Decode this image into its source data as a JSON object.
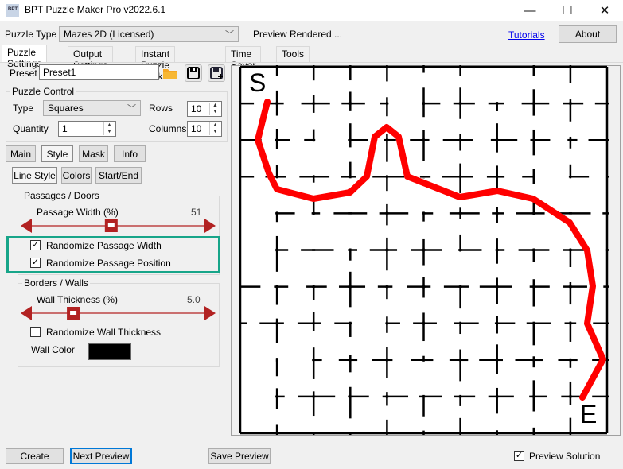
{
  "window": {
    "title": "BPT Puzzle Maker Pro v2022.6.1",
    "icon": "bpt-app-icon",
    "icon_text": "BPT",
    "minimize": "—",
    "maximize": "☐",
    "close": "✕"
  },
  "header": {
    "puzzle_type_label": "Puzzle Type",
    "puzzle_type_value": "Mazes 2D (Licensed)",
    "status": "Preview Rendered ...",
    "tutorials_link": "Tutorials",
    "about_button": "About"
  },
  "tabs": [
    {
      "label": "Puzzle Settings",
      "active": true
    },
    {
      "label": "Output Settings",
      "active": false
    },
    {
      "label": "Instant Puzzle Books",
      "active": false
    },
    {
      "label": "Time Saver",
      "active": false
    },
    {
      "label": "Tools",
      "active": false
    }
  ],
  "preset": {
    "label": "Preset",
    "value": "Preset1",
    "open_icon": "folder-icon",
    "save_icon": "save-icon",
    "save_as_icon": "save-plus-icon"
  },
  "puzzle_control": {
    "title": "Puzzle Control",
    "type_label": "Type",
    "type_value": "Squares",
    "rows_label": "Rows",
    "rows_value": "10",
    "quantity_label": "Quantity",
    "quantity_value": "1",
    "columns_label": "Columns",
    "columns_value": "10"
  },
  "sub_tabs": [
    {
      "label": "Main",
      "active": false
    },
    {
      "label": "Style",
      "active": true
    },
    {
      "label": "Mask",
      "active": false
    },
    {
      "label": "Info",
      "active": false
    }
  ],
  "style_tabs": [
    {
      "label": "Line Style",
      "active": true
    },
    {
      "label": "Colors",
      "active": false
    },
    {
      "label": "Start/End",
      "active": false
    }
  ],
  "passages": {
    "title": "Passages / Doors",
    "slider_label": "Passage Width (%)",
    "slider_value": "51",
    "slider_fraction": 0.46,
    "randomize_width_label": "Randomize Passage Width",
    "randomize_width_checked": true,
    "randomize_position_label": "Randomize Passage Position",
    "randomize_position_checked": true,
    "highlight_color": "#17a589"
  },
  "borders": {
    "title": "Borders / Walls",
    "slider_label": "Wall Thickness (%)",
    "slider_value": "5.0",
    "slider_fraction": 0.24,
    "randomize_label": "Randomize Wall Thickness",
    "randomize_checked": false,
    "wall_color_label": "Wall Color",
    "wall_color": "#000000"
  },
  "slider_color": "#b22222",
  "maze": {
    "rows": 10,
    "columns": 10,
    "start_label": "S",
    "end_label": "E",
    "solution_color": "#ff0000"
  },
  "footer": {
    "create_button": "Create",
    "next_preview_button": "Next Preview",
    "save_preview_button": "Save Preview",
    "preview_solution_label": "Preview Solution",
    "preview_solution_checked": true
  }
}
